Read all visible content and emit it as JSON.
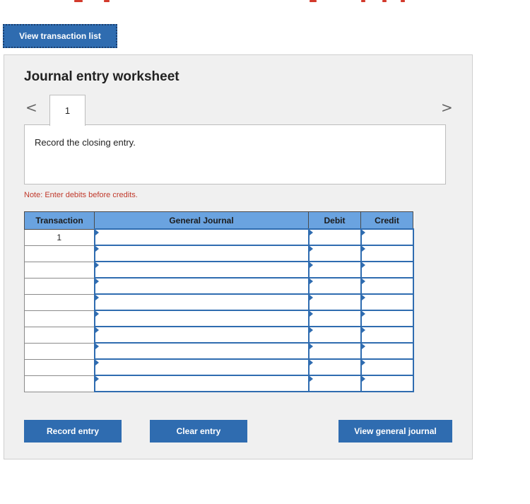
{
  "header": {
    "view_transaction_list": "View transaction list"
  },
  "worksheet": {
    "title": "Journal entry worksheet",
    "nav_prev_glyph": "<",
    "nav_next_glyph": ">",
    "active_tab": "1",
    "instruction": "Record the closing entry.",
    "note": "Note: Enter debits before credits."
  },
  "table": {
    "columns": [
      "Transaction",
      "General Journal",
      "Debit",
      "Credit"
    ],
    "rows": [
      {
        "transaction": "1"
      },
      {
        "transaction": ""
      },
      {
        "transaction": ""
      },
      {
        "transaction": ""
      },
      {
        "transaction": ""
      },
      {
        "transaction": ""
      },
      {
        "transaction": ""
      },
      {
        "transaction": ""
      },
      {
        "transaction": ""
      },
      {
        "transaction": ""
      }
    ]
  },
  "buttons": {
    "record_entry": "Record entry",
    "clear_entry": "Clear entry",
    "view_general_journal": "View general journal"
  },
  "colors": {
    "primary": "#2f6cb0",
    "header_fill": "#6aa3e0",
    "note_red": "#c0392b",
    "top_line_red": "#d33a2c"
  }
}
